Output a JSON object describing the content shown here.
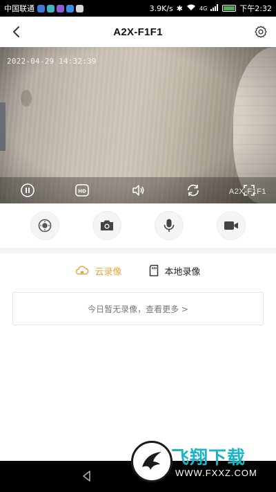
{
  "status_bar": {
    "carrier": "中国联通",
    "app_icon_colors": [
      "#3b7bd8",
      "#3fb4c5",
      "#8e5bd0",
      "#3a8ee6",
      "#d8d8d8"
    ],
    "net_speed": "3.9K/s",
    "signal_label": "4G",
    "time": "下午2:32"
  },
  "header": {
    "title": "A2X-F1F1",
    "back_icon": "chevron-left-icon",
    "settings_icon": "gear-icon"
  },
  "video": {
    "timestamp": "2022-04-29 14:32:39",
    "overlay_name": "A2X-F1F1",
    "controls": [
      "pause-icon",
      "hd-icon",
      "volume-icon",
      "rotate-icon",
      "fullscreen-icon"
    ]
  },
  "actions": [
    "ptz-icon",
    "camera-icon",
    "microphone-icon",
    "video-record-icon"
  ],
  "tabs": [
    {
      "label": "云录像",
      "icon": "cloud-icon",
      "active": true
    },
    {
      "label": "本地录像",
      "icon": "sd-card-icon",
      "active": false
    }
  ],
  "record_box": {
    "text": "今日暂无录像，查看更多 >"
  },
  "colors": {
    "accent": "#e8a33d",
    "watermark_teal": "#1ab3c7"
  },
  "watermark": {
    "brand": "飞翔下载",
    "domain": "WWW.FXXZ.COM"
  }
}
